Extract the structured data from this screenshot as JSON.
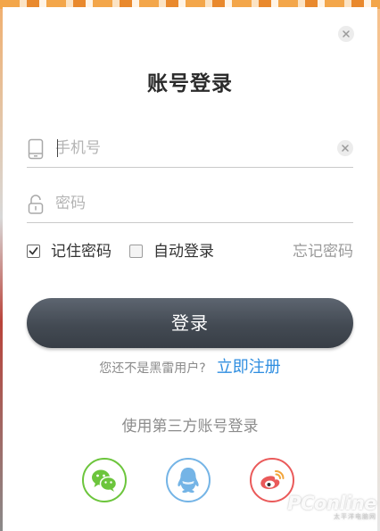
{
  "dialog": {
    "title": "账号登录",
    "close_icon": "close-icon"
  },
  "phone_field": {
    "placeholder": "手机号",
    "value": "",
    "icon": "mobile-phone-icon",
    "clear_icon": "clear-icon"
  },
  "password_field": {
    "placeholder": "密码",
    "value": "",
    "icon": "lock-icon"
  },
  "options": {
    "remember_label": "记住密码",
    "remember_checked": true,
    "auto_login_label": "自动登录",
    "auto_login_checked": false,
    "forgot_label": "忘记密码"
  },
  "login_button": {
    "label": "登录"
  },
  "register": {
    "prompt": "您还不是黑雷用户?",
    "link": "立即注册"
  },
  "third_party": {
    "title": "使用第三方账号登录",
    "providers": [
      {
        "id": "wechat",
        "icon": "wechat-icon",
        "color": "#6cc53c"
      },
      {
        "id": "qq",
        "icon": "qq-icon",
        "color": "#74b4e6"
      },
      {
        "id": "weibo",
        "icon": "weibo-icon",
        "color": "#ea5a5a"
      }
    ]
  },
  "watermark": {
    "text": "PConline",
    "subtext": "太平洋电脑网"
  },
  "colors": {
    "accent_link": "#2f8ee0",
    "button_dark": "#434a53"
  }
}
